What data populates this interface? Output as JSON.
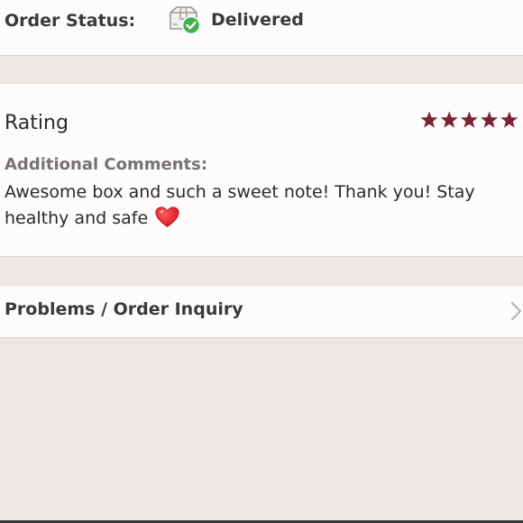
{
  "order_status": {
    "label": "Order Status:",
    "value": "Delivered",
    "icon": "package-delivered-icon",
    "check_color": "#3fb24f"
  },
  "review": {
    "rating_label": "Rating",
    "rating": 5,
    "rating_max": 5,
    "star_color": "#7c2432",
    "comments_label": "Additional Comments:",
    "comment_text": "Awesome box and such a sweet note! Thank you! Stay healthy and safe",
    "comment_emoji": "heart-icon"
  },
  "inquiry": {
    "label": "Problems / Order Inquiry",
    "chevron": "chevron-right-icon"
  }
}
